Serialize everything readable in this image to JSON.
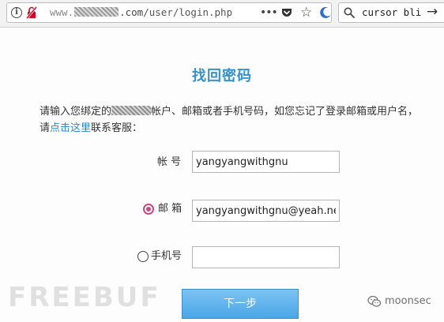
{
  "browser": {
    "url_prefix": "www.",
    "url_suffix": ".com",
    "url_path": "/user/login.php",
    "search_text": "cursor bli",
    "more_glyph": "•••",
    "star_glyph": "☆",
    "arrow_glyph": "→",
    "info_glyph": "i"
  },
  "page": {
    "title": "找回密码",
    "intro_part1": "请输入您绑定的",
    "intro_part2": "帐户、邮箱或者手机号码，如您忘记了登录邮箱或用户名，",
    "intro_line2_prefix": "请",
    "intro_link": "点击这里",
    "intro_line2_suffix": "联系客服："
  },
  "form": {
    "account_label": "帐 号",
    "account_value": "yangyangwithgnu",
    "email_label": "邮 箱",
    "email_value": "yangyangwithgnu@yeah.net",
    "phone_label": "手机号",
    "phone_value": "",
    "selected_method": "email",
    "submit_label": "下一步"
  },
  "watermarks": {
    "left": "FREEBUF",
    "right": "moonsec"
  },
  "colors": {
    "title": "#3292d2",
    "link": "#2d8ad2",
    "radio_checked": "#d0477f",
    "button_top": "#7cc3f3",
    "button_bottom": "#4aa6e6"
  }
}
